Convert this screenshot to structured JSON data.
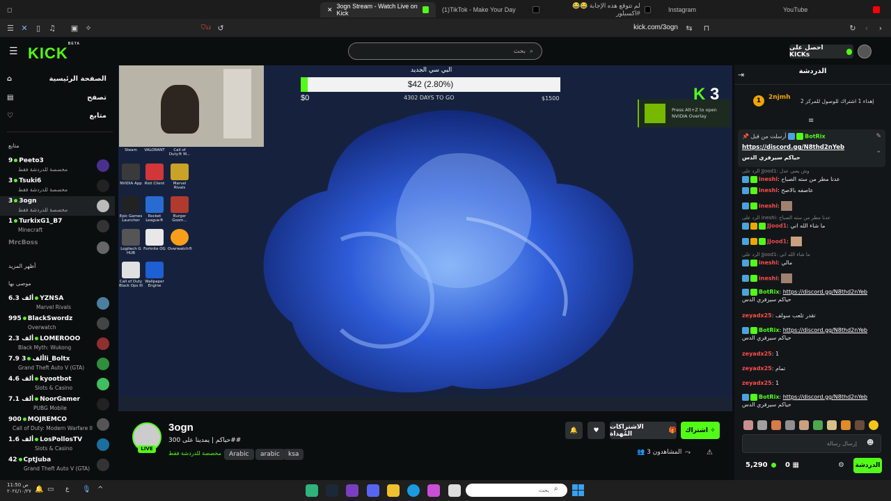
{
  "browser": {
    "tabs": [
      {
        "label": "3ogn Stream - Watch Live on Kick",
        "active": true
      },
      {
        "label": "(1)TikTok - Make Your Day",
        "active": false
      },
      {
        "label": "لم تتوقع هذه الإجابة 😂😂 #اكسبلور",
        "active": false
      },
      {
        "label": "Instagram",
        "active": false
      },
      {
        "label": "YouTube",
        "active": false
      }
    ],
    "url": "kick.com/3ogn",
    "brave_count": "12"
  },
  "header": {
    "logo": "KICK",
    "logo_badge": "BETA",
    "search_placeholder": "بحث",
    "get_kicks": "احصل على KICKs"
  },
  "sidebar": {
    "nav": [
      {
        "label": "الصفحة الرئيسية",
        "icon": "home-icon"
      },
      {
        "label": "تصفح",
        "icon": "browse-icon"
      },
      {
        "label": "متابع",
        "icon": "heart-icon"
      }
    ],
    "following_title": "متابع",
    "following": [
      {
        "name": "Peeto3",
        "count": "9",
        "game": "مخصصة للدردشة فقط"
      },
      {
        "name": "Tsuki6",
        "count": "3",
        "game": "مخصصة للدردشة فقط"
      },
      {
        "name": "3ogn",
        "count": "3",
        "game": "مخصصة للدردشة فقط"
      },
      {
        "name": "TurkixG1_B7",
        "count": "1",
        "game": "Minecraft"
      },
      {
        "name": "MrcBoss",
        "count": "",
        "game": ""
      }
    ],
    "show_more": "أظهر المزيد",
    "recommended_title": "موصى بها",
    "recommended": [
      {
        "name": "YZNSA",
        "count": "6.3 ألف",
        "game": "Marvel Rivals"
      },
      {
        "name": "BlackSwordz",
        "count": "995",
        "game": "Overwatch"
      },
      {
        "name": "LOMEROOO",
        "count": "2.3 ألف",
        "game": "Black Myth: Wukong"
      },
      {
        "name": "3li_Boltx",
        "count": "7.9 ألف",
        "game": "Grand Theft Auto V (GTA)"
      },
      {
        "name": "kyootbot",
        "count": "4.6 ألف",
        "game": "Slots & Casino"
      },
      {
        "name": "NoorGamer",
        "count": "7.1 ألف",
        "game": "PUBG Mobile"
      },
      {
        "name": "MOJREMCO",
        "count": "900",
        "game": "Call of Duty: Modern Warfare II"
      },
      {
        "name": "LosPollosTV",
        "count": "1.6 ألف",
        "game": "Slots & Casino"
      },
      {
        "name": "CptJuba",
        "count": "42",
        "game": "Grand Theft Auto V (GTA)"
      }
    ]
  },
  "video": {
    "goal_title": "البي سي الجديد",
    "goal_value": "$42 (2.80%)",
    "goal_progress_percent": 2.8,
    "goal_min": "$0",
    "goal_days": "4302 DAYS TO GO",
    "goal_max": "$1500",
    "kick_count": "3",
    "nvidia_text": "Press Alt+Z to open NVIDIA Overlay",
    "desktop_icons": [
      "Steam",
      "VALORANT",
      "Call of Duty® M...",
      "NVIDIA App",
      "Riot Client",
      "Marvel Rivals",
      "Epic Games Launcher",
      "Rocket League®",
      "Burger Goom...",
      "Logitech G HUB",
      "Fortnite OG",
      "Overwatch®",
      "Call of Duty Black Ops III",
      "Wallpaper Engine"
    ]
  },
  "stream": {
    "name": "3ogn",
    "title": "حياكم | يمدينا على 300##",
    "category": "مخصصة للدردشة فقط",
    "live": "LIVE",
    "tags": [
      "Arabic",
      "arabic",
      "ksa"
    ],
    "subscribe": "اشتراك",
    "gift_subs": "الاشتراكات المُهداة",
    "viewers_label": "المشاهدون",
    "viewers": "3"
  },
  "chat": {
    "title": "الدردشة",
    "top_gifter": "2njmh",
    "gift_text": "إهداء 1 اشتراك للوصول للمركز 2",
    "pinned_user": "BotRix",
    "pinned_by": "أرسلت من قبل",
    "pinned_link": "https://discord.gg/N8thd2nYeb",
    "pinned_text": "حياكم سيرفري الدس",
    "messages": [
      {
        "reply": "الرد على JJood1: وش يعني عدل",
        "user": "ineshi",
        "text": "عدنا مطر من سته الصباح"
      },
      {
        "reply": "",
        "user": "ineshi",
        "text": "عاصفه بالاصح"
      },
      {
        "reply": "",
        "user": "ineshi",
        "text": ""
      },
      {
        "reply": "الرد على ineshi: عدنا مطر من سته الصباح",
        "user": "JJood1",
        "text": "ما شاء الله اني"
      },
      {
        "reply": "",
        "user": "JJood1",
        "text": ""
      },
      {
        "reply": "الرد على JJood1: ما شاء الله اني",
        "user": "ineshi",
        "text": "مالي"
      },
      {
        "reply": "",
        "user": "ineshi",
        "text": ""
      },
      {
        "reply": "",
        "user": "BotRix",
        "link": "https://discord.gg/N8thd2nYeb",
        "text": "حياكم سيرفري الدس"
      },
      {
        "reply": "",
        "user": "zeyadx25",
        "text": "تقدر تلعب سولف"
      },
      {
        "reply": "",
        "user": "BotRix",
        "link": "https://discord.gg/N8thd2nYeb",
        "text": "حياكم سيرفري الدس"
      },
      {
        "reply": "",
        "user": "zeyadx25",
        "text": "1"
      },
      {
        "reply": "",
        "user": "zeyadx25",
        "text": "تمام"
      },
      {
        "reply": "",
        "user": "zeyadx25",
        "text": "1"
      },
      {
        "reply": "",
        "user": "BotRix",
        "link": "https://discord.gg/N8thd2nYeb",
        "text": "حياكم سيرفري الدس"
      }
    ],
    "input_placeholder": "إرسال رسالة",
    "points": "5,290",
    "kicks": "0",
    "send": "الدردشة"
  },
  "taskbar": {
    "search": "بحث",
    "time": "11:50 ص",
    "date": "٢٠٢٤/١٠/٢٧",
    "lang": "ع"
  },
  "colors": {
    "accent": "#53fc18",
    "bg": "#0b0e0f",
    "chat_bg": "#121618"
  }
}
